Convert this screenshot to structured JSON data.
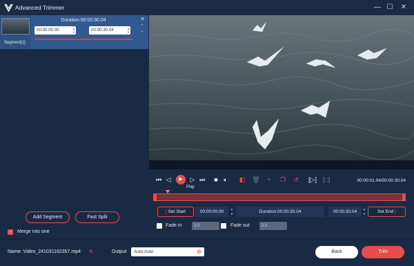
{
  "app": {
    "title": "Advanced Trimmer"
  },
  "window": {
    "minimize": "—",
    "maximize": "☐",
    "close": "✕"
  },
  "segment": {
    "duration": "Duration:00:00:30.04",
    "start": "00:00:00.00",
    "end": "00:00:30.04",
    "label": "Segment[1]"
  },
  "left_actions": {
    "add_segment": "Add Segment",
    "fast_split": "Fast Split"
  },
  "merge": {
    "label": "Merge into one",
    "checked": true
  },
  "player": {
    "play_tooltip": "Play",
    "time": "00:00:01.04/00:00:30.04",
    "progress_fraction": 0.035
  },
  "trim": {
    "set_start": "Set Start",
    "start_time": "00:00:00.00",
    "duration": "Duration:00:00:30.04",
    "end_time": "00:00:30.04",
    "set_end": "Set End"
  },
  "fade": {
    "fade_in_label": "Fade in",
    "fade_in_value": "3.0",
    "fade_out_label": "Fade out",
    "fade_out_value": "3.0"
  },
  "bottom": {
    "name": "Name: Video_241031162357.mp4",
    "output_label": "Output:",
    "output_value": "Auto;Auto",
    "back": "Back",
    "trim": "Trim"
  },
  "colors": {
    "accent": "#e84c4c",
    "panel": "#1b2a44",
    "selected": "#2e5182"
  }
}
